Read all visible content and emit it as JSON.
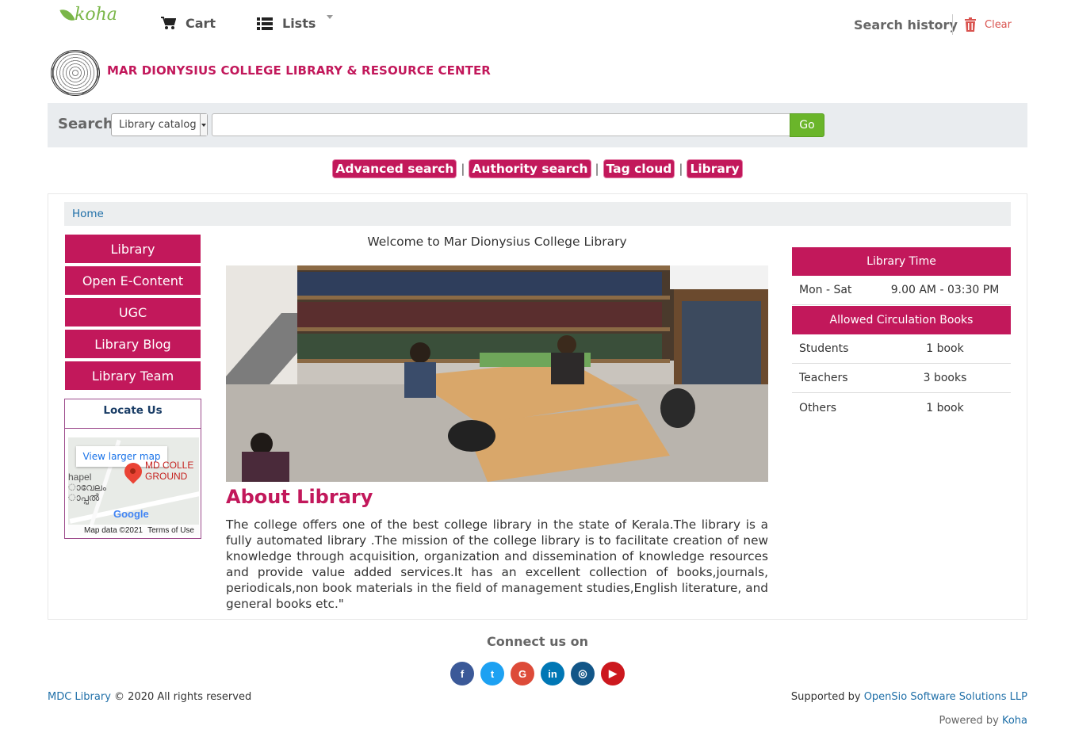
{
  "topbar": {
    "logo": "koha",
    "cart_label": "Cart",
    "lists_label": "Lists",
    "search_history_label": "Search history",
    "clear_label": "Clear"
  },
  "header": {
    "site_title": "MAR DIONYSIUS COLLEGE LIBRARY & RESOURCE CENTER"
  },
  "search": {
    "label": "Search",
    "scope_selected": "Library catalog",
    "query_value": "",
    "go_label": "Go"
  },
  "more_searches": [
    {
      "label": "Advanced search"
    },
    {
      "label": "Authority search"
    },
    {
      "label": "Tag cloud"
    },
    {
      "label": "Library"
    }
  ],
  "more_searches_separator": "|",
  "breadcrumb": {
    "home": "Home"
  },
  "sidebar": {
    "items": [
      {
        "label": "Library"
      },
      {
        "label": "Open E-Content"
      },
      {
        "label": "UGC"
      },
      {
        "label": "Library Blog"
      },
      {
        "label": "Library Team"
      }
    ],
    "locate_title": "Locate Us",
    "map": {
      "larger_map_label": "View larger map",
      "place_label_line1": "MD COLLE",
      "place_label_line2": "GROUND",
      "left_label_line1": "hapel",
      "left_label_line2": "ാവേലം",
      "left_label_line3": "ാപ്പൽ",
      "google": "Google",
      "map_data": "Map data ©2021",
      "terms": "Terms of Use"
    }
  },
  "main": {
    "welcome": "Welcome to Mar Dionysius College Library",
    "about_title": "About Library",
    "about_body": "The college offers one of the best college library in the state of Kerala.The library is a fully automated library .The mission of the college library is to facilitate creation of new knowledge through acquisition, organization and dissemination of knowledge resources and provide value added services.It has an excellent collection of books,journals, periodicals,non book materials in the field of management studies,English literature, and general books etc.\""
  },
  "library_time": {
    "heading": "Library Time",
    "days": "Mon - Sat",
    "hours": "9.00 AM - 03:30 PM"
  },
  "circulation": {
    "heading": "Allowed Circulation Books",
    "rows": [
      {
        "who": "Students",
        "limit": "1 book"
      },
      {
        "who": "Teachers",
        "limit": "3 books"
      },
      {
        "who": "Others",
        "limit": "1 book"
      }
    ]
  },
  "footer": {
    "connect_label": "Connect us on",
    "social": [
      {
        "icon": "facebook-icon",
        "glyph": "f",
        "color": "#3b5998"
      },
      {
        "icon": "twitter-icon",
        "glyph": "t",
        "color": "#1da1f2"
      },
      {
        "icon": "google-icon",
        "glyph": "G",
        "color": "#dd4b39"
      },
      {
        "icon": "linkedin-icon",
        "glyph": "in",
        "color": "#0077b5"
      },
      {
        "icon": "instagram-icon",
        "glyph": "◎",
        "color": "#125688"
      },
      {
        "icon": "youtube-icon",
        "glyph": "▶",
        "color": "#cc181e"
      }
    ],
    "site_link": "MDC Library",
    "copyright": "© 2020 All rights reserved",
    "supported_by": "Supported by",
    "supporter_link": "OpenSio Software Solutions LLP",
    "powered_by": "Powered by",
    "powered_link": "Koha"
  },
  "colors": {
    "accent": "#c2185b",
    "go_button": "#6ab52a",
    "link": "#1f6fa8"
  }
}
